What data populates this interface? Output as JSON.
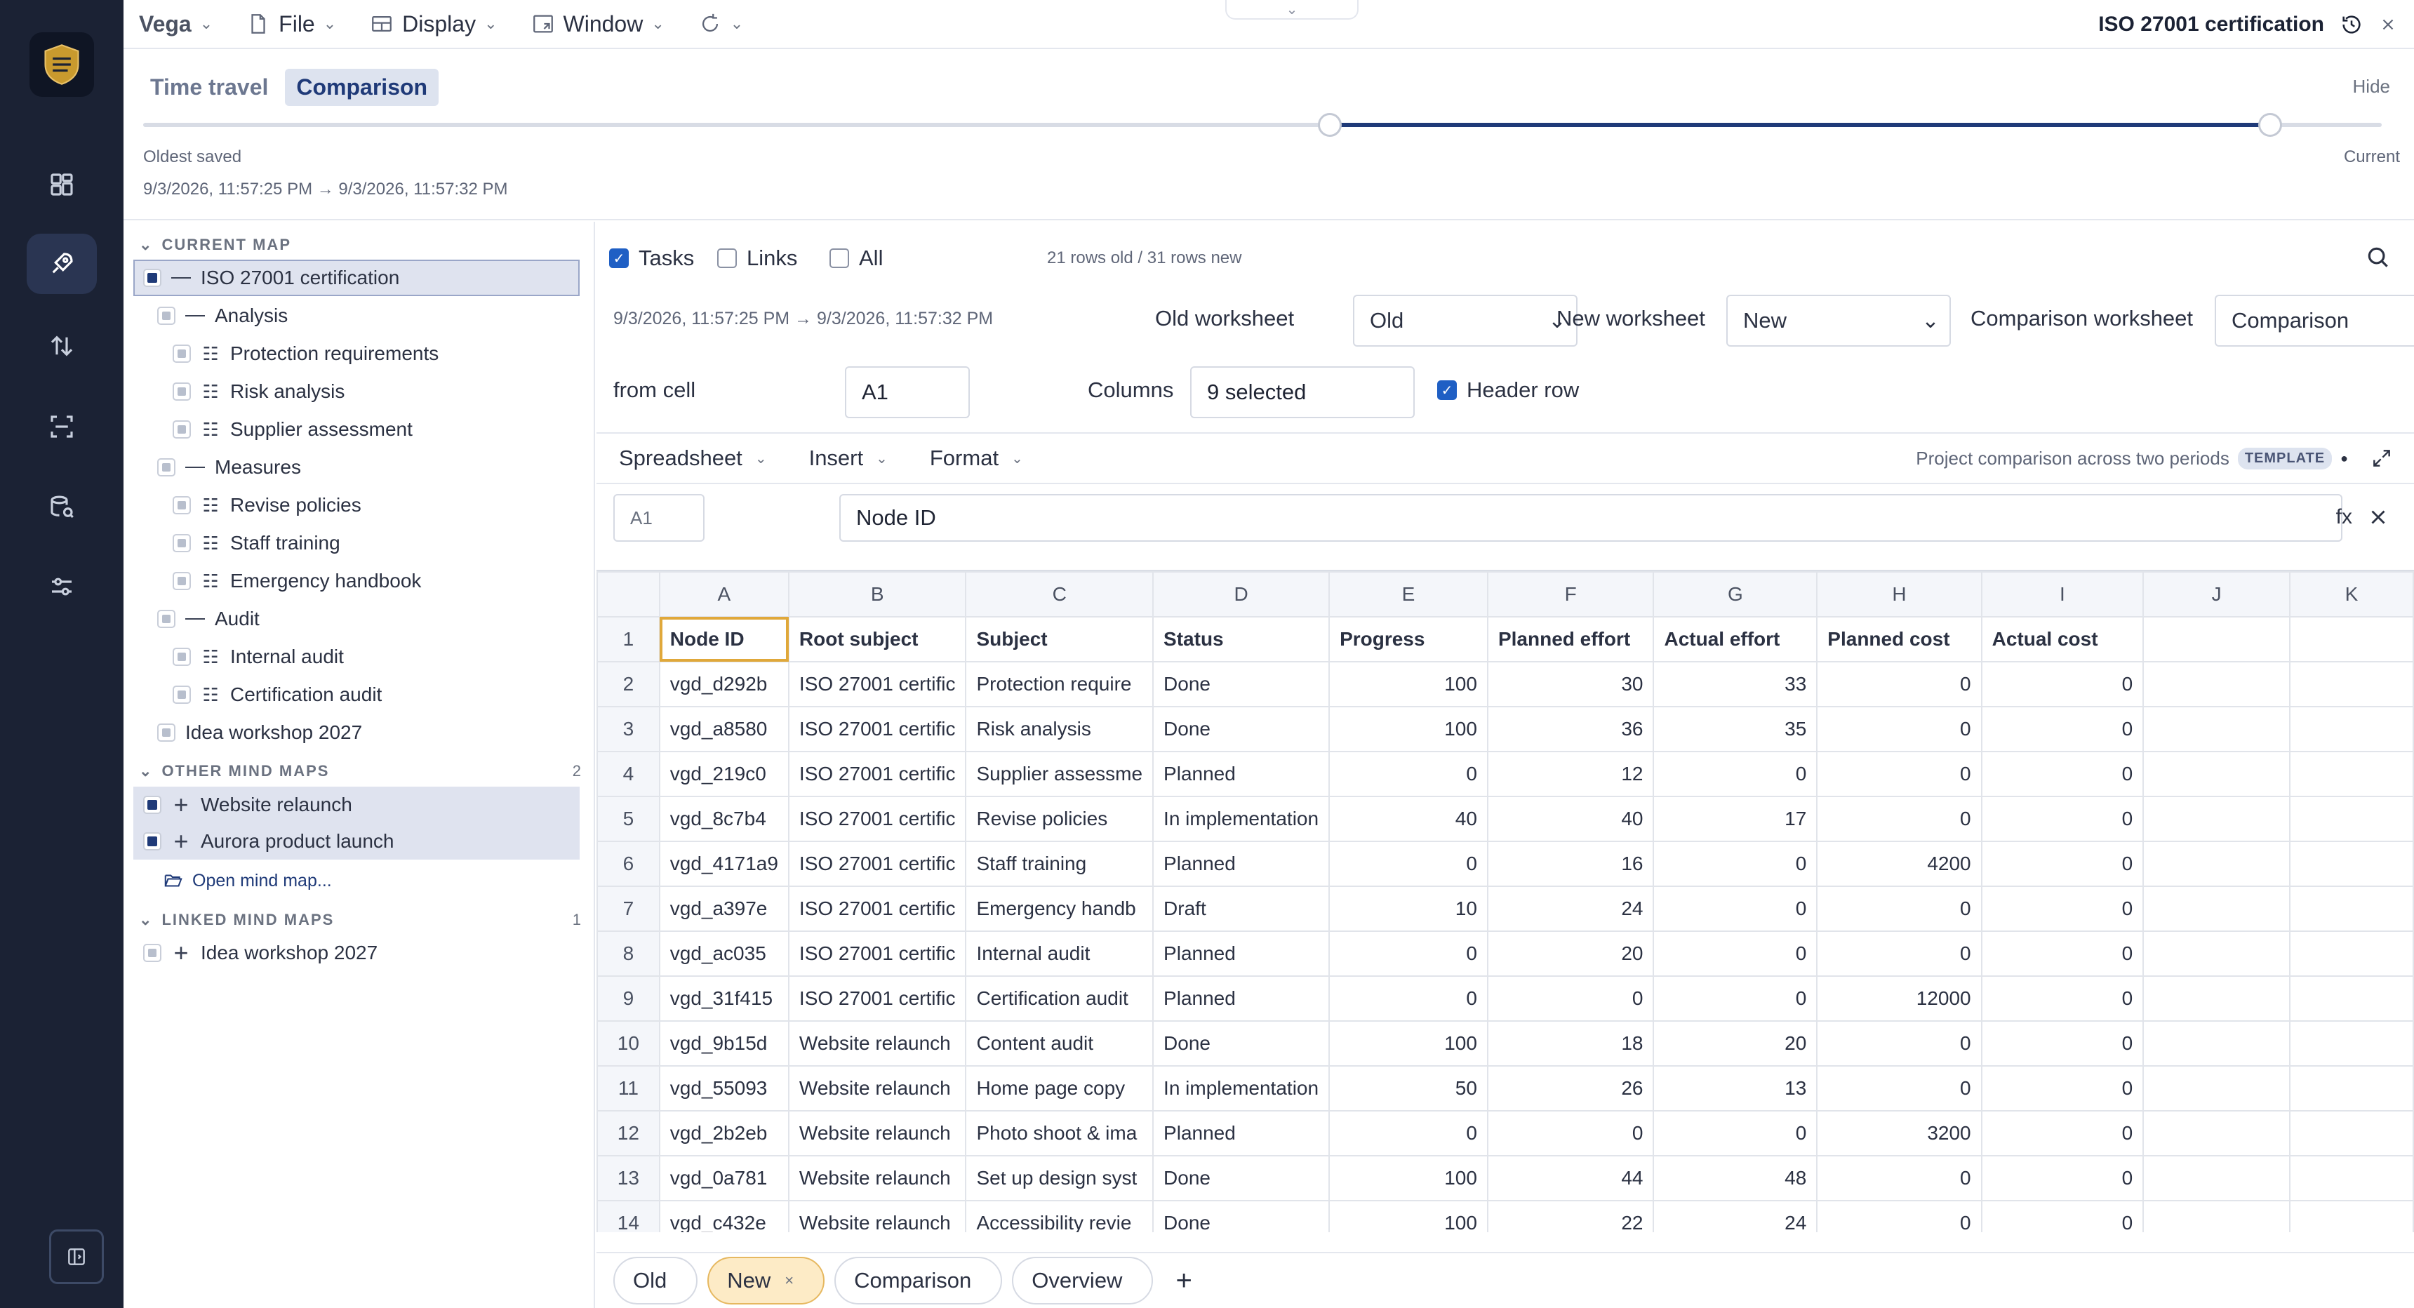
{
  "app": {
    "name": "Vega",
    "document_title": "ISO 27001 certification"
  },
  "menus": [
    {
      "label": "File",
      "icon": "file-icon"
    },
    {
      "label": "Display",
      "icon": "layout-icon"
    },
    {
      "label": "Window",
      "icon": "window-icon"
    }
  ],
  "timetravel": {
    "tabs": [
      "Time travel",
      "Comparison"
    ],
    "active_tab": "Comparison",
    "hide_label": "Hide",
    "oldest_label": "Oldest saved",
    "current_label": "Current",
    "range_text": "9/3/2026, 11:57:25 PM → 9/3/2026, 11:57:32 PM",
    "selected_range_fraction": [
      0.53,
      0.95
    ]
  },
  "sidebar": {
    "current_map_heading": "CURRENT MAP",
    "tree": [
      {
        "label": "ISO 27001 certification",
        "level": 0,
        "kind": "dash",
        "check": "on"
      },
      {
        "label": "Analysis",
        "level": 1,
        "kind": "dash",
        "check": "part"
      },
      {
        "label": "Protection requirements",
        "level": 2,
        "kind": "list",
        "check": "part"
      },
      {
        "label": "Risk analysis",
        "level": 2,
        "kind": "list",
        "check": "part"
      },
      {
        "label": "Supplier assessment",
        "level": 2,
        "kind": "list",
        "check": "part"
      },
      {
        "label": "Measures",
        "level": 1,
        "kind": "dash",
        "check": "part"
      },
      {
        "label": "Revise policies",
        "level": 2,
        "kind": "list",
        "check": "part"
      },
      {
        "label": "Staff training",
        "level": 2,
        "kind": "list",
        "check": "part"
      },
      {
        "label": "Emergency handbook",
        "level": 2,
        "kind": "list",
        "check": "part"
      },
      {
        "label": "Audit",
        "level": 1,
        "kind": "dash",
        "check": "part"
      },
      {
        "label": "Internal audit",
        "level": 2,
        "kind": "list",
        "check": "part"
      },
      {
        "label": "Certification audit",
        "level": 2,
        "kind": "list",
        "check": "part"
      },
      {
        "label": "Idea workshop 2027",
        "level": 1,
        "kind": "none",
        "check": "part"
      }
    ],
    "other_maps_heading": "OTHER MIND MAPS",
    "other_maps_count": "2",
    "other_maps": [
      "Website relaunch",
      "Aurora product launch"
    ],
    "open_map_label": "Open mind map...",
    "linked_maps_heading": "LINKED MIND MAPS",
    "linked_maps_count": "1",
    "linked_maps": [
      "Idea workshop 2027"
    ]
  },
  "controls": {
    "tasks_label": "Tasks",
    "tasks_checked": true,
    "links_label": "Links",
    "links_checked": false,
    "all_label": "All",
    "all_checked": false,
    "rows_info": "21 rows old / 31 rows new",
    "range_text": "9/3/2026, 11:57:25 PM → 9/3/2026, 11:57:32 PM",
    "old_ws_label": "Old worksheet",
    "old_ws_value": "Old",
    "new_ws_label": "New worksheet",
    "new_ws_value": "New",
    "cmp_ws_label": "Comparison worksheet",
    "cmp_ws_value": "Comparison",
    "from_cell_label": "from cell",
    "from_cell_value": "A1",
    "columns_label": "Columns",
    "columns_value": "9 selected",
    "header_row_label": "Header row",
    "header_row_checked": true
  },
  "sheet_toolbar": {
    "menus": [
      "Spreadsheet",
      "Insert",
      "Format"
    ],
    "description": "Project comparison across two periods",
    "badge": "TEMPLATE"
  },
  "formula_bar": {
    "cell": "A1",
    "value": "Node ID",
    "fx": "fx"
  },
  "grid": {
    "column_letters": [
      "A",
      "B",
      "C",
      "D",
      "E",
      "F",
      "G",
      "H",
      "I",
      "J",
      "K"
    ],
    "rows": [
      [
        "Node ID",
        "Root subject",
        "Subject",
        "Status",
        "Progress",
        "Planned effort",
        "Actual effort",
        "Planned cost",
        "Actual cost",
        "",
        ""
      ],
      [
        "vgd_d292b",
        "ISO 27001 certific",
        "Protection require",
        "Done",
        "100",
        "30",
        "33",
        "0",
        "0",
        "",
        ""
      ],
      [
        "vgd_a8580",
        "ISO 27001 certific",
        "Risk analysis",
        "Done",
        "100",
        "36",
        "35",
        "0",
        "0",
        "",
        ""
      ],
      [
        "vgd_219c0",
        "ISO 27001 certific",
        "Supplier assessme",
        "Planned",
        "0",
        "12",
        "0",
        "0",
        "0",
        "",
        ""
      ],
      [
        "vgd_8c7b4",
        "ISO 27001 certific",
        "Revise policies",
        "In implementation",
        "40",
        "40",
        "17",
        "0",
        "0",
        "",
        ""
      ],
      [
        "vgd_4171a9",
        "ISO 27001 certific",
        "Staff training",
        "Planned",
        "0",
        "16",
        "0",
        "4200",
        "0",
        "",
        ""
      ],
      [
        "vgd_a397e",
        "ISO 27001 certific",
        "Emergency handb",
        "Draft",
        "10",
        "24",
        "0",
        "0",
        "0",
        "",
        ""
      ],
      [
        "vgd_ac035",
        "ISO 27001 certific",
        "Internal audit",
        "Planned",
        "0",
        "20",
        "0",
        "0",
        "0",
        "",
        ""
      ],
      [
        "vgd_31f415",
        "ISO 27001 certific",
        "Certification audit",
        "Planned",
        "0",
        "0",
        "0",
        "12000",
        "0",
        "",
        ""
      ],
      [
        "vgd_9b15d",
        "Website relaunch",
        "Content audit",
        "Done",
        "100",
        "18",
        "20",
        "0",
        "0",
        "",
        ""
      ],
      [
        "vgd_55093",
        "Website relaunch",
        "Home page copy",
        "In implementation",
        "50",
        "26",
        "13",
        "0",
        "0",
        "",
        ""
      ],
      [
        "vgd_2b2eb",
        "Website relaunch",
        "Photo shoot & ima",
        "Planned",
        "0",
        "0",
        "0",
        "3200",
        "0",
        "",
        ""
      ],
      [
        "vgd_0a781",
        "Website relaunch",
        "Set up design syst",
        "Done",
        "100",
        "44",
        "48",
        "0",
        "0",
        "",
        ""
      ],
      [
        "vgd_c432e",
        "Website relaunch",
        "Accessibility revie",
        "Done",
        "100",
        "22",
        "24",
        "0",
        "0",
        "",
        ""
      ]
    ]
  },
  "sheet_tabs": [
    {
      "label": "Old",
      "active": false
    },
    {
      "label": "New",
      "active": true,
      "close": "×"
    },
    {
      "label": "Comparison",
      "active": false
    },
    {
      "label": "Overview",
      "active": false
    }
  ],
  "add_sheet_label": "+",
  "colors": {
    "rail": "#1b2234",
    "accent": "#1f3a78",
    "checkbox": "#1f5fc4",
    "active_tab": "#fdebc6",
    "cell_focus": "#e0a83a"
  }
}
